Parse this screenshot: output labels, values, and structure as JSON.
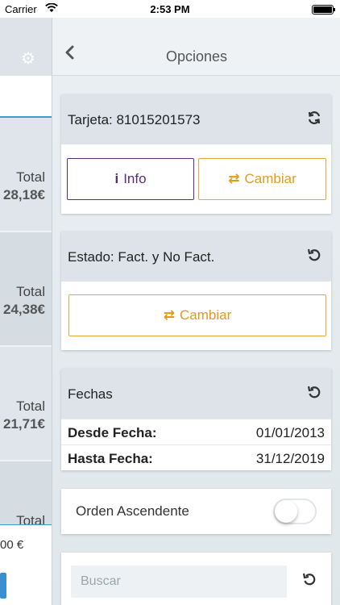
{
  "status_bar": {
    "carrier": "Carrier",
    "time": "2:53 PM"
  },
  "background_panel": {
    "rows": [
      {
        "label": "Total",
        "amount": "28,18€"
      },
      {
        "label": "Total",
        "amount": "24,38€"
      },
      {
        "label": "Total",
        "amount": "21,71€"
      },
      {
        "label": "Total"
      }
    ],
    "bottom_value": "00 €"
  },
  "header": {
    "title": "Opciones"
  },
  "tarjeta": {
    "title": "Tarjeta: 81015201573",
    "info_label": "Info",
    "cambiar_label": "Cambiar"
  },
  "estado": {
    "title": "Estado: Fact. y No Fact.",
    "cambiar_label": "Cambiar"
  },
  "fechas": {
    "title": "Fechas",
    "desde_label": "Desde Fecha:",
    "desde_value": "01/01/2013",
    "hasta_label": "Hasta Fecha:",
    "hasta_value": "31/12/2019"
  },
  "orden": {
    "label": "Orden Ascendente",
    "enabled": false
  },
  "search": {
    "placeholder": "Buscar"
  },
  "colors": {
    "purple": "#5b2d7a",
    "orange": "#e39a1b",
    "blue": "#3aa0c8"
  },
  "icons": [
    "wifi-icon",
    "battery-icon",
    "gears-icon",
    "chevron-left-icon",
    "refresh-icon",
    "undo-icon",
    "info-icon",
    "swap-icon"
  ]
}
